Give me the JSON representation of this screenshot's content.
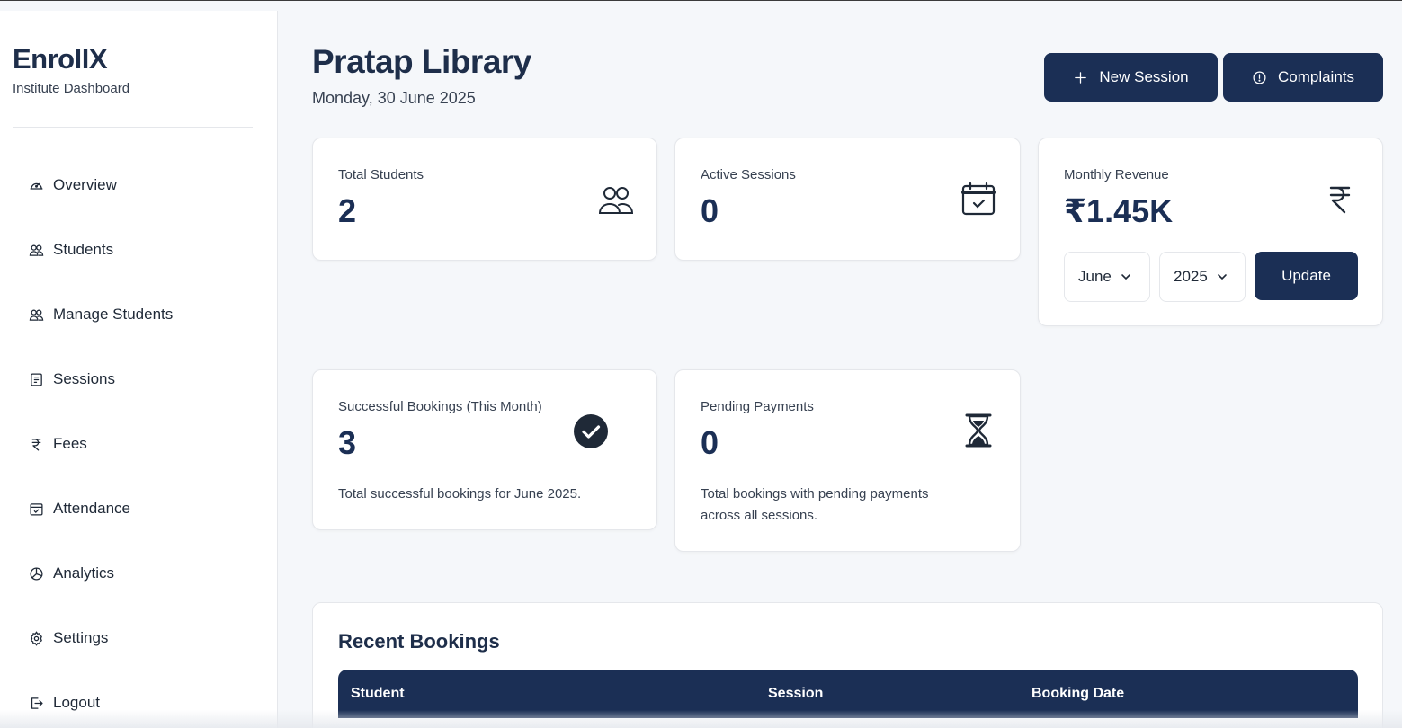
{
  "sidebar": {
    "brand_title": "EnrollX",
    "brand_subtitle": "Institute Dashboard",
    "items": [
      {
        "label": "Overview",
        "icon": "gauge-icon"
      },
      {
        "label": "Students",
        "icon": "users-icon"
      },
      {
        "label": "Manage Students",
        "icon": "users-icon"
      },
      {
        "label": "Sessions",
        "icon": "document-icon"
      },
      {
        "label": "Fees",
        "icon": "rupee-icon"
      },
      {
        "label": "Attendance",
        "icon": "calendar-check-icon"
      },
      {
        "label": "Analytics",
        "icon": "pie-chart-icon"
      },
      {
        "label": "Settings",
        "icon": "gear-icon"
      },
      {
        "label": "Logout",
        "icon": "logout-icon"
      }
    ]
  },
  "header": {
    "title": "Pratap Library",
    "date": "Monday, 30 June 2025",
    "new_session_label": "New Session",
    "complaints_label": "Complaints"
  },
  "stats": {
    "total_students": {
      "label": "Total Students",
      "value": "2"
    },
    "active_sessions": {
      "label": "Active Sessions",
      "value": "0"
    },
    "monthly_revenue": {
      "label": "Monthly Revenue",
      "value": "₹1.45K",
      "month": "June",
      "year": "2025",
      "update_label": "Update"
    },
    "successful_bookings": {
      "label": "Successful Bookings (This Month)",
      "value": "3",
      "description": "Total successful bookings for June 2025."
    },
    "pending_payments": {
      "label": "Pending Payments",
      "value": "0",
      "description_line1": "Total bookings with pending payments",
      "description_line2": "across all sessions."
    }
  },
  "recent_bookings": {
    "title": "Recent Bookings",
    "columns": [
      "Student",
      "Session",
      "Booking Date"
    ]
  },
  "colors": {
    "primary": "#1b2f55",
    "background": "#f5f7fa",
    "card": "#ffffff"
  }
}
